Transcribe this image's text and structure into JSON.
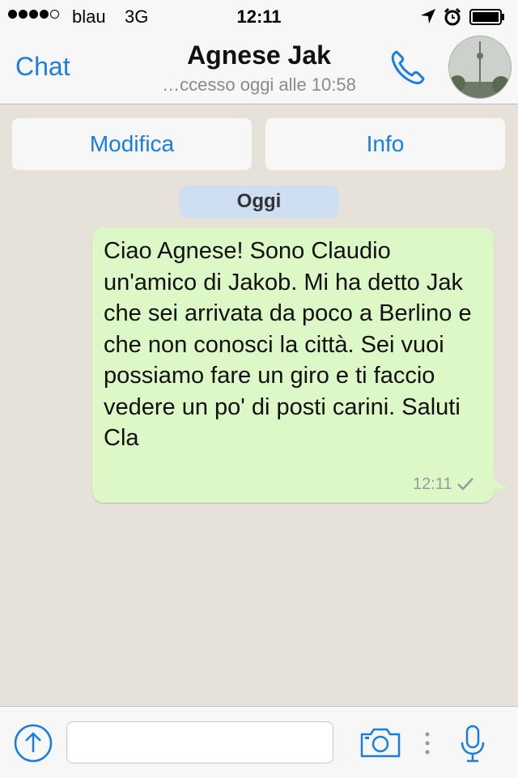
{
  "status_bar": {
    "carrier": "blau",
    "network": "3G",
    "time": "12:11",
    "signal_bars": 4,
    "signal_max": 5
  },
  "nav": {
    "back_label": "Chat",
    "title": "Agnese Jak",
    "subtitle": "…ccesso oggi alle 10:58"
  },
  "actions": {
    "edit_label": "Modifica",
    "info_label": "Info"
  },
  "conversation": {
    "date_label": "Oggi",
    "messages": [
      {
        "text": "Ciao Agnese! Sono Claudio un'amico di Jakob. Mi ha detto Jak che sei arrivata da poco a Berlino e che non conosci la città. Sei vuoi possiamo fare un giro e ti faccio vedere un po' di posti carini. Saluti Cla",
        "time": "12:11",
        "status": "sent"
      }
    ]
  },
  "input": {
    "value": "",
    "placeholder": ""
  },
  "colors": {
    "accent": "#1a7ee0",
    "bubble_outgoing": "#dcf8c6",
    "chat_background": "#e6e1d9",
    "date_pill": "#cfdff3"
  },
  "icons": {
    "location": "location-arrow-icon",
    "alarm": "alarm-clock-icon",
    "battery": "battery-icon",
    "call": "phone-icon",
    "upload": "upload-arrow-icon",
    "camera": "camera-icon",
    "more": "more-dots-icon",
    "mic": "microphone-icon"
  }
}
